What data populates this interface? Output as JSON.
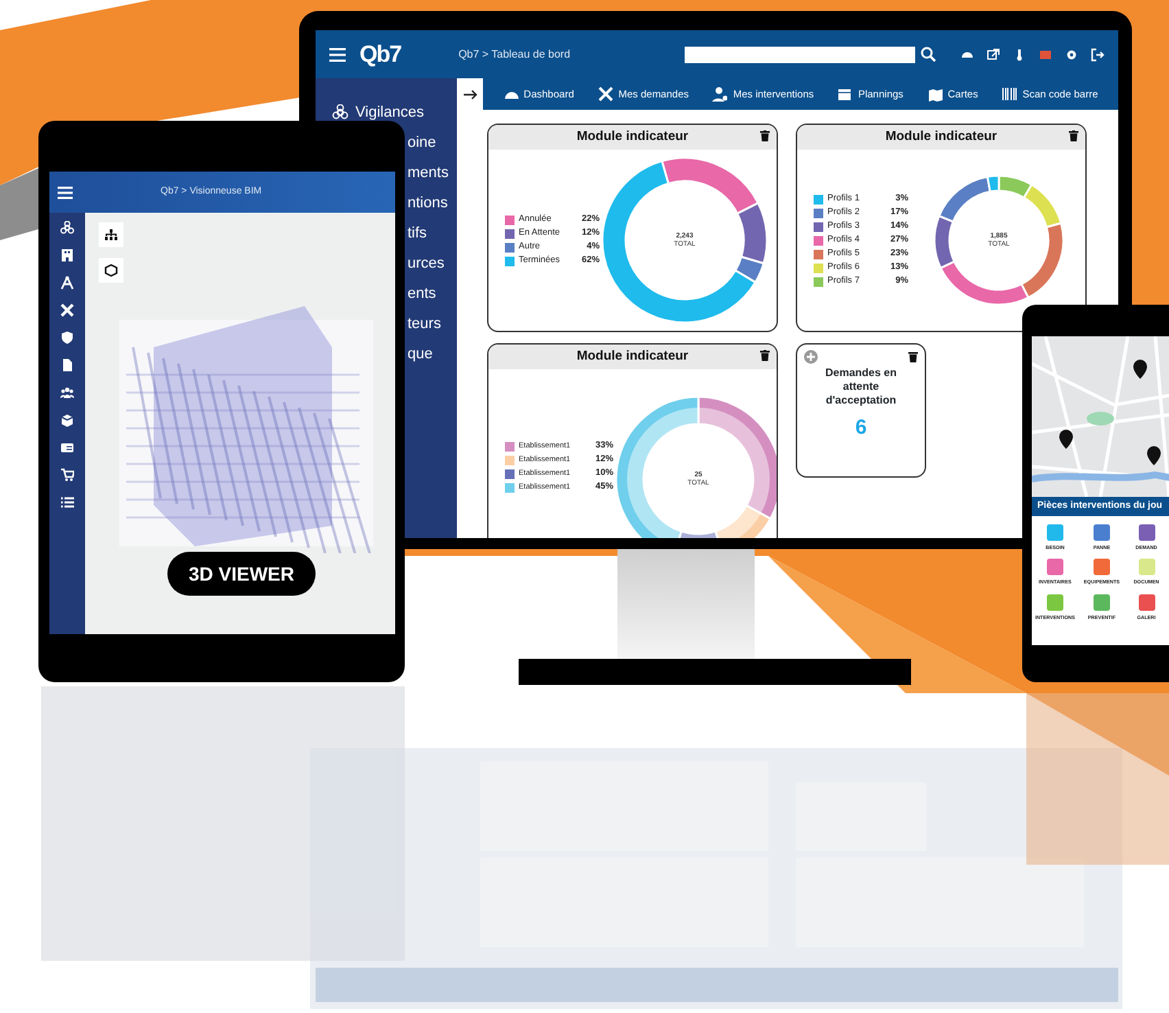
{
  "monitor": {
    "logo": "Qb7",
    "breadcrumb": "Qb7 > Tableau de bord",
    "sidebar": {
      "items": [
        {
          "label": "Vigilances"
        },
        {
          "label": "oine"
        },
        {
          "label": "ments"
        },
        {
          "label": "ntions"
        },
        {
          "label": "tifs"
        },
        {
          "label": "urces"
        },
        {
          "label": "ents"
        },
        {
          "label": "teurs"
        },
        {
          "label": "que"
        }
      ]
    },
    "nav": [
      {
        "label": "Dashboard"
      },
      {
        "label": "Mes demandes"
      },
      {
        "label": "Mes interventions"
      },
      {
        "label": "Plannings"
      },
      {
        "label": "Cartes"
      },
      {
        "label": "Scan code barre"
      }
    ],
    "cards": [
      {
        "kind": "donut",
        "title": "Module indicateur",
        "total": "2,243",
        "total_label": "TOTAL",
        "legend": [
          {
            "percent": "22%",
            "color": "#e868a8"
          },
          {
            "percent": "12%",
            "color": "#7266b0"
          },
          {
            "percent": "4%",
            "color": "#5a7fc4"
          },
          {
            "percent": "62%",
            "color": "#1ebbec"
          }
        ],
        "chart_data": {
          "type": "donut",
          "categories": [
            "Annulée",
            "En Attente",
            "Autre",
            "Terminées"
          ],
          "values": [
            22,
            12,
            4,
            62
          ]
        }
      },
      {
        "kind": "donut",
        "title": "Module indicateur",
        "total": "1,885",
        "total_label": "TOTAL",
        "legend": [
          {
            "percent": "3%",
            "color": "#1ebbec"
          },
          {
            "percent": "17%",
            "color": "#5a7fc4"
          },
          {
            "percent": "14%",
            "color": "#7266b0"
          },
          {
            "percent": "27%",
            "color": "#e868a8"
          },
          {
            "percent": "23%",
            "color": "#d9765a"
          },
          {
            "percent": "13%",
            "color": "#dde050"
          },
          {
            "percent": "9%",
            "color": "#8ac95a"
          }
        ],
        "chart_data": {
          "type": "donut",
          "categories": [
            "Profils 1",
            "Profils 2",
            "Profils 3",
            "Profils 4",
            "Profils 5",
            "Profils 6",
            "Profils 7"
          ],
          "values": [
            2.83,
            16.04,
            13.21,
            25.47,
            21.7,
            12.26,
            8.49
          ]
        }
      },
      {
        "kind": "double-donut",
        "title": "Module indicateur",
        "total": "25",
        "total_label": "TOTAL",
        "legend": [
          {
            "percent": "33%",
            "color": "#d48fc0"
          },
          {
            "percent": "12%",
            "color": "#fbcfa6"
          },
          {
            "percent": "10%",
            "color": "#6670b8"
          },
          {
            "percent": "45%",
            "color": "#6fcfec"
          }
        ],
        "chart_data": {
          "type": "donut",
          "categories": [
            "Etablissement1",
            "Etablissement1",
            "Etablissement1",
            "Etablissement1"
          ],
          "values": [
            33,
            12,
            10,
            45
          ]
        }
      },
      {
        "kind": "counter",
        "title": "Demandes en attente d'acceptation",
        "value": "6"
      }
    ]
  },
  "tablet": {
    "breadcrumb": "Qb7 > Visionneuse BIM",
    "button": "3D VIEWER"
  },
  "phone": {
    "section_title": "Pièces interventions du jou",
    "tiles": [
      {
        "label": "BESOIN",
        "color": "#21b8ec"
      },
      {
        "label": "PANNE",
        "color": "#4a7fd0"
      },
      {
        "label": "DEMAND",
        "color": "#7a5fb5"
      },
      {
        "label": "INVENTAIRES",
        "color": "#e868a8"
      },
      {
        "label": "EQUIPEMENTS",
        "color": "#f06a3a"
      },
      {
        "label": "DOCUMEN",
        "color": "#d9e88a"
      },
      {
        "label": "INTERVENTIONS",
        "color": "#7cc742"
      },
      {
        "label": "PREVENTIF",
        "color": "#5cb85c"
      },
      {
        "label": "GALERI",
        "color": "#ea5050"
      }
    ]
  }
}
